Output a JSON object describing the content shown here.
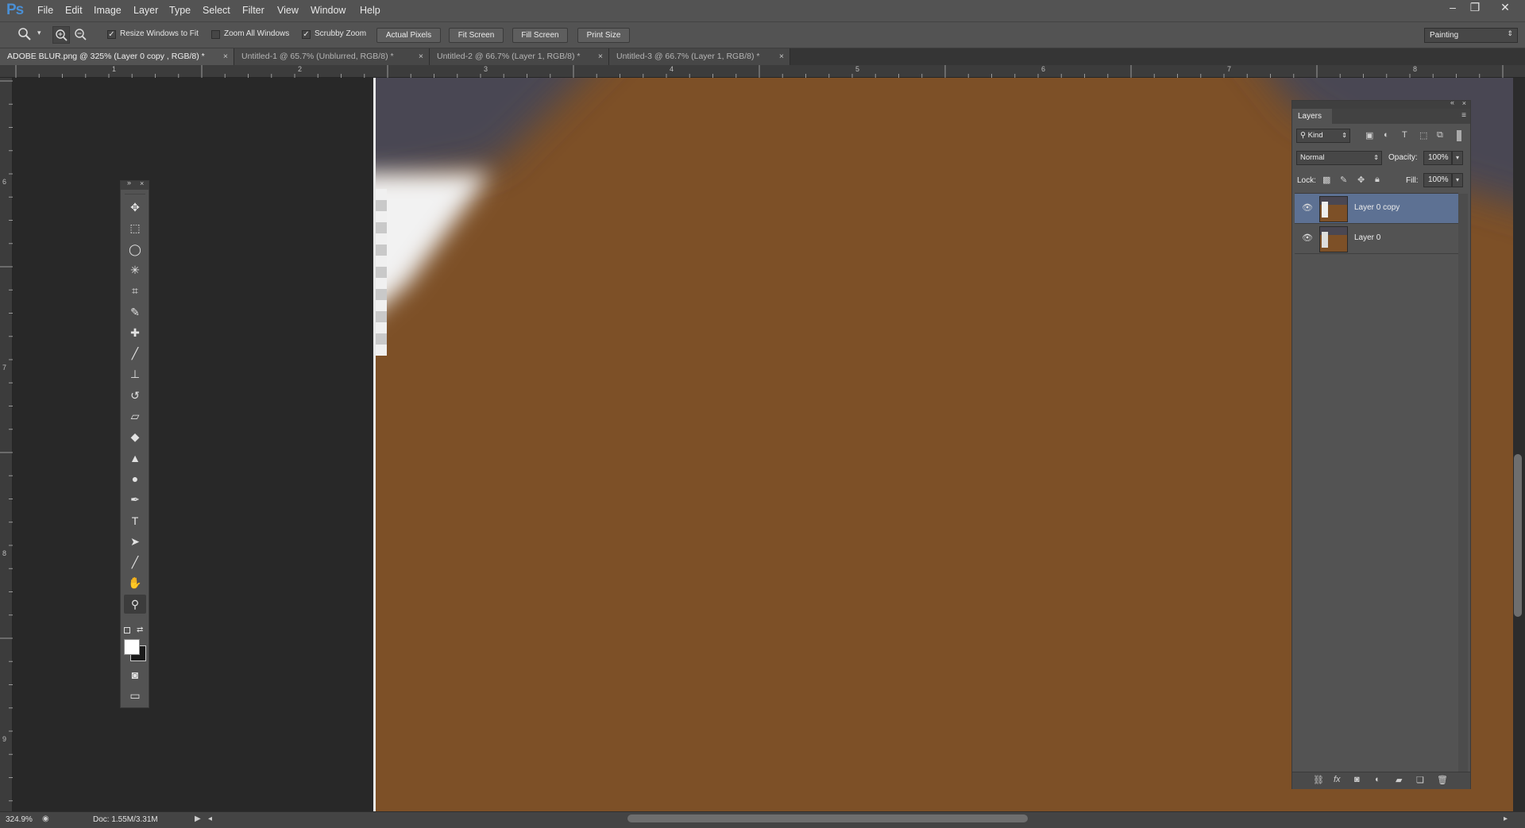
{
  "app": {
    "logo": "Ps"
  },
  "menu": [
    "File",
    "Edit",
    "Image",
    "Layer",
    "Type",
    "Select",
    "Filter",
    "View",
    "Window",
    "Help"
  ],
  "window_controls": {
    "minimize": "–",
    "restore": "❐",
    "close": "✕"
  },
  "options_bar": {
    "zoom_dropdown_arrow": "▾",
    "resize_windows_label": "Resize Windows to Fit",
    "resize_windows_checked": true,
    "zoom_all_label": "Zoom All Windows",
    "zoom_all_checked": false,
    "scrubby_label": "Scrubby Zoom",
    "scrubby_checked": true,
    "actual_pixels": "Actual Pixels",
    "fit_screen": "Fit Screen",
    "fill_screen": "Fill Screen",
    "print_size": "Print Size",
    "workspace": "Painting"
  },
  "tabs": [
    {
      "label": "ADOBE BLUR.png @ 325% (Layer 0 copy , RGB/8) *",
      "active": true
    },
    {
      "label": "Untitled-1 @ 65.7% (Unblurred, RGB/8) *",
      "active": false
    },
    {
      "label": "Untitled-2 @ 66.7% (Layer 1, RGB/8) *",
      "active": false
    },
    {
      "label": "Untitled-3 @ 66.7% (Layer 1, RGB/8) *",
      "active": false
    }
  ],
  "tab_close": "×",
  "ruler": {
    "h_labels": [
      "1",
      "2",
      "3",
      "4",
      "5",
      "6",
      "7",
      "8"
    ],
    "v_labels": [
      "6",
      "7",
      "8",
      "9"
    ]
  },
  "tools": [
    {
      "name": "move-tool",
      "icon": "✥"
    },
    {
      "name": "marquee-tool",
      "icon": "⬚"
    },
    {
      "name": "lasso-tool",
      "icon": "◯"
    },
    {
      "name": "magic-wand-tool",
      "icon": "✳"
    },
    {
      "name": "crop-tool",
      "icon": "⌗"
    },
    {
      "name": "eyedropper-tool",
      "icon": "✎"
    },
    {
      "name": "healing-brush-tool",
      "icon": "✚"
    },
    {
      "name": "brush-tool",
      "icon": "╱"
    },
    {
      "name": "clone-stamp-tool",
      "icon": "⊥"
    },
    {
      "name": "history-brush-tool",
      "icon": "↺"
    },
    {
      "name": "eraser-tool",
      "icon": "▱"
    },
    {
      "name": "paint-bucket-tool",
      "icon": "◆"
    },
    {
      "name": "blur-tool",
      "icon": "▲"
    },
    {
      "name": "dodge-tool",
      "icon": "●"
    },
    {
      "name": "pen-tool",
      "icon": "✒"
    },
    {
      "name": "type-tool",
      "icon": "T"
    },
    {
      "name": "path-selection-tool",
      "icon": "➤"
    },
    {
      "name": "line-tool",
      "icon": "╱"
    },
    {
      "name": "hand-tool",
      "icon": "✋"
    },
    {
      "name": "zoom-tool",
      "icon": "⚲"
    }
  ],
  "layers_panel": {
    "title": "Layers",
    "filter_kind": "Kind",
    "blend_mode": "Normal",
    "opacity_label": "Opacity:",
    "opacity_value": "100%",
    "lock_label": "Lock:",
    "fill_label": "Fill:",
    "fill_value": "100%",
    "layers": [
      {
        "name": "Layer 0 copy",
        "selected": true
      },
      {
        "name": "Layer 0",
        "selected": false
      }
    ],
    "footer_icons": [
      "link-icon",
      "fx-icon",
      "mask-icon",
      "adjustment-icon",
      "folder-icon",
      "new-layer-icon",
      "trash-icon"
    ]
  },
  "status": {
    "zoom": "324.9%",
    "doc": "Doc: 1.55M/3.31M"
  },
  "colors": {
    "canvas_brown": "#7d5027",
    "canvas_dark": "#4a4752",
    "highlight_white": "#f0f0f0",
    "selected_layer": "#5d7193"
  }
}
